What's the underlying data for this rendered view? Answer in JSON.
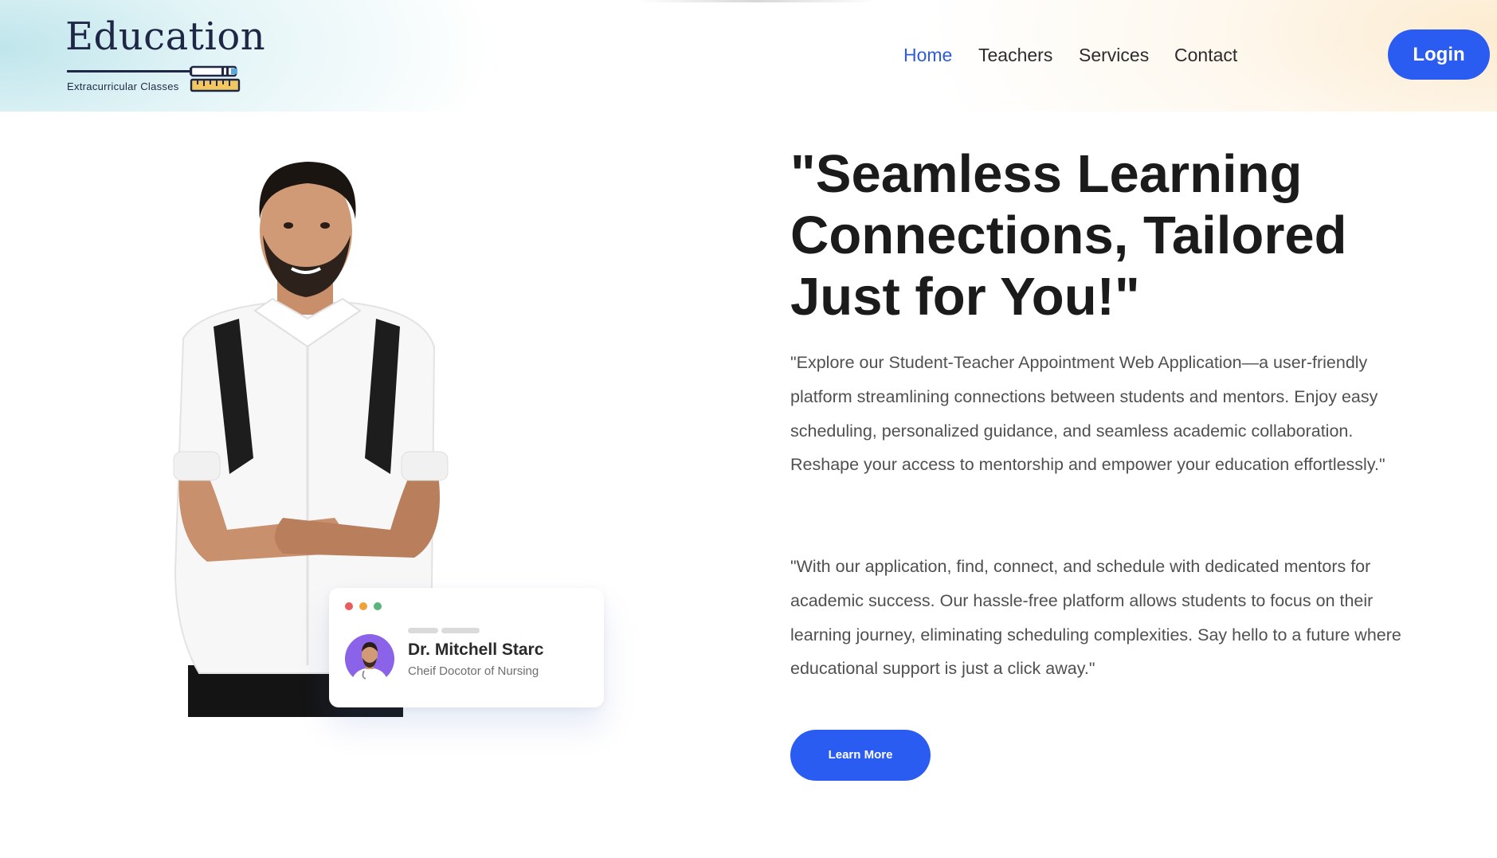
{
  "brand": {
    "title": "Education",
    "subtitle": "Extracurricular Classes"
  },
  "nav": {
    "items": [
      {
        "label": "Home",
        "active": true
      },
      {
        "label": "Teachers",
        "active": false
      },
      {
        "label": "Services",
        "active": false
      },
      {
        "label": "Contact",
        "active": false
      }
    ],
    "login_label": "Login"
  },
  "hero": {
    "headline": "\"Seamless Learning Connections, Tailored Just for You!\"",
    "paragraph_1": "\"Explore our Student-Teacher Appointment Web Application—a user-friendly platform streamlining connections between students and mentors. Enjoy easy scheduling, personalized guidance, and seamless academic collaboration. Reshape your access to mentorship and empower your education effortlessly.\"",
    "paragraph_2": "\"With our application, find, connect, and schedule with dedicated mentors for academic success. Our hassle-free platform allows students to focus on their learning journey, eliminating scheduling complexities. Say hello to a future where educational support is just a click away.\"",
    "cta_label": "Learn More"
  },
  "profile_card": {
    "name": "Dr. Mitchell Starc",
    "role": "Cheif Docotor of Nursing"
  },
  "colors": {
    "accent": "#2a5cf2",
    "nav_active": "#2f5bdc",
    "brand_dark": "#1f2747",
    "avatar_bg": "#8a63e8"
  },
  "icons": {
    "logo_mark": "pencil-ruler-icon",
    "avatar": "doctor-avatar",
    "window_dots": [
      "red-dot",
      "orange-dot",
      "green-dot"
    ]
  }
}
